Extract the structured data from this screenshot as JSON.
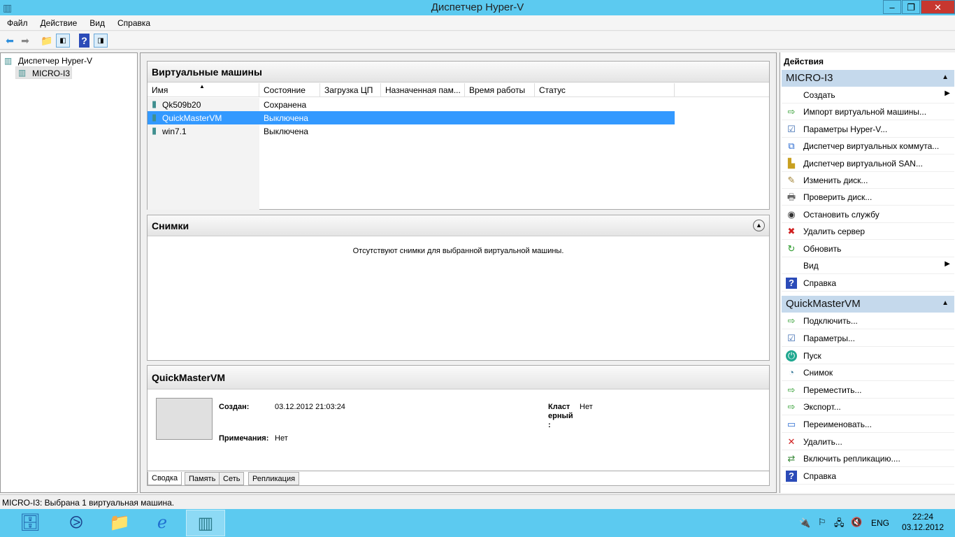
{
  "window": {
    "title": "Диспетчер Hyper-V",
    "minimize": "–",
    "restore": "❐",
    "close": "✕"
  },
  "menu": [
    "Файл",
    "Действие",
    "Вид",
    "Справка"
  ],
  "tree": {
    "root": "Диспетчер Hyper-V",
    "server": "MICRO-I3"
  },
  "vms": {
    "title": "Виртуальные машины",
    "columns": [
      "Имя",
      "Состояние",
      "Загрузка ЦП",
      "Назначенная пам...",
      "Время работы",
      "Статус"
    ],
    "rows": [
      {
        "name": "Qk509b20",
        "state": "Сохранена"
      },
      {
        "name": "QuickMasterVM",
        "state": "Выключена"
      },
      {
        "name": "win7.1",
        "state": "Выключена"
      }
    ]
  },
  "snapshots": {
    "title": "Снимки",
    "empty": "Отсутствуют снимки для выбранной виртуальной машины."
  },
  "details": {
    "title": "QuickMasterVM",
    "created_label": "Создан:",
    "created": "03.12.2012 21:03:24",
    "notes_label": "Примечания:",
    "notes": "Нет",
    "clustered_label": "Класт ерный :",
    "clustered": "Нет",
    "tabs": [
      "Сводка",
      "Память",
      "Сеть",
      "Репликация"
    ]
  },
  "actions": {
    "title": "Действия",
    "sections": [
      {
        "title": "MICRO-I3",
        "items": [
          {
            "label": "Создать",
            "icon": "",
            "arrow": true
          },
          {
            "label": "Импорт виртуальной машины...",
            "icon": "import"
          },
          {
            "label": "Параметры Hyper-V...",
            "icon": "settings"
          },
          {
            "label": "Диспетчер виртуальных коммута...",
            "icon": "switch"
          },
          {
            "label": "Диспетчер виртуальной SAN...",
            "icon": "san"
          },
          {
            "label": "Изменить диск...",
            "icon": "edit-disk"
          },
          {
            "label": "Проверить диск...",
            "icon": "inspect-disk"
          },
          {
            "label": "Остановить службу",
            "icon": "stop"
          },
          {
            "label": "Удалить сервер",
            "icon": "remove"
          },
          {
            "label": "Обновить",
            "icon": "refresh"
          },
          {
            "label": "Вид",
            "icon": "",
            "arrow": true
          },
          {
            "label": "Справка",
            "icon": "help"
          }
        ]
      },
      {
        "title": "QuickMasterVM",
        "items": [
          {
            "label": "Подключить...",
            "icon": "connect"
          },
          {
            "label": "Параметры...",
            "icon": "settings"
          },
          {
            "label": "Пуск",
            "icon": "start"
          },
          {
            "label": "Снимок",
            "icon": "snapshot"
          },
          {
            "label": "Переместить...",
            "icon": "move"
          },
          {
            "label": "Экспорт...",
            "icon": "export"
          },
          {
            "label": "Переименовать...",
            "icon": "rename"
          },
          {
            "label": "Удалить...",
            "icon": "delete"
          },
          {
            "label": "Включить репликацию....",
            "icon": "replication"
          },
          {
            "label": "Справка",
            "icon": "help"
          }
        ]
      }
    ]
  },
  "status": "MICRO-I3:  Выбрана 1 виртуальная машина.",
  "tray": {
    "lang": "ENG",
    "time": "22:24",
    "date": "03.12.2012"
  },
  "colors": {
    "accent": "#5ccaf0",
    "selection": "#3399ff",
    "section": "#c5d9ec"
  }
}
